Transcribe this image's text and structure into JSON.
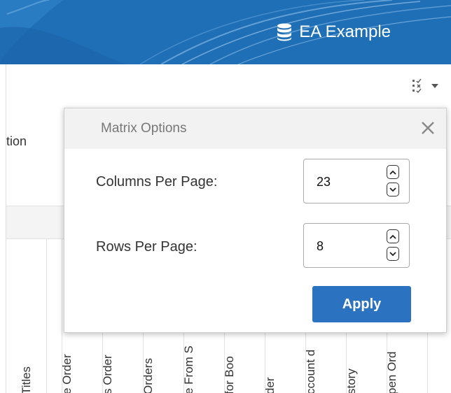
{
  "header": {
    "brand_text": "EA Example",
    "brand_icon": "database-icon",
    "background_color": "#1f6fb6"
  },
  "toolbar": {
    "view_options_icon": "checklist-icon",
    "dropdown_icon": "caret-down-icon"
  },
  "content": {
    "option_label_fragment": "tion",
    "column_headers": [
      "",
      "Titles",
      "e Order",
      "s Order",
      "Orders",
      "e From S",
      "for Boo",
      "der",
      "ccount d",
      "story",
      "pen Ord"
    ]
  },
  "popover": {
    "title": "Matrix Options",
    "close_icon": "close-icon",
    "columns_per_page": {
      "label": "Columns Per Page:",
      "value": "23"
    },
    "rows_per_page": {
      "label": "Rows Per Page:",
      "value": "8"
    },
    "apply_label": "Apply",
    "apply_color": "#2b73c1"
  }
}
